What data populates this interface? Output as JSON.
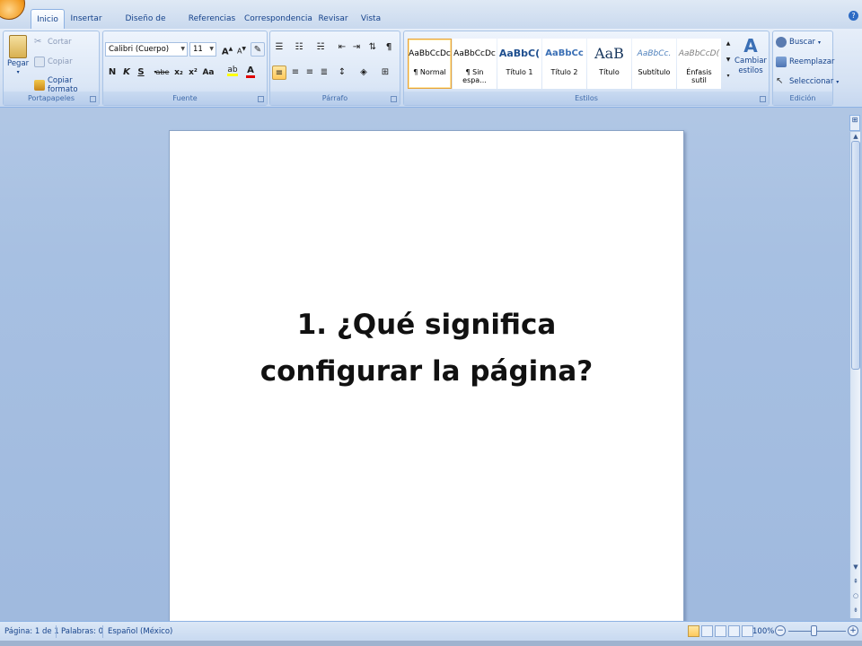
{
  "tabs": [
    {
      "label": "Inicio",
      "active": true
    },
    {
      "label": "Insertar"
    },
    {
      "label": "Diseño de página"
    },
    {
      "label": "Referencias"
    },
    {
      "label": "Correspondencia"
    },
    {
      "label": "Revisar"
    },
    {
      "label": "Vista"
    }
  ],
  "clipboard": {
    "paste": "Pegar",
    "cut": "Cortar",
    "copy": "Copiar",
    "format_painter": "Copiar formato",
    "label": "Portapapeles"
  },
  "font": {
    "family": "Calibri (Cuerpo)",
    "size": "11",
    "label": "Fuente",
    "bold": "N",
    "italic": "K",
    "underline": "S",
    "strike": "abe",
    "subscript": "x₂",
    "superscript": "x²",
    "case": "Aa"
  },
  "paragraph": {
    "label": "Párrafo"
  },
  "styles": {
    "label": "Estilos",
    "items": [
      {
        "preview": "AaBbCcDc",
        "name": "¶ Normal",
        "selected": true
      },
      {
        "preview": "AaBbCcDc",
        "name": "¶ Sin espa..."
      },
      {
        "preview": "AaBbC(",
        "name": "Título 1"
      },
      {
        "preview": "AaBbCc",
        "name": "Título 2"
      },
      {
        "preview": "AaB",
        "name": "Título"
      },
      {
        "preview": "AaBbCc.",
        "name": "Subtítulo"
      },
      {
        "preview": "AaBbCcD(",
        "name": "Énfasis sutil"
      }
    ],
    "change_styles": "Cambiar estilos"
  },
  "editing": {
    "label": "Edición",
    "find": "Buscar",
    "replace": "Reemplazar",
    "select": "Seleccionar"
  },
  "document": {
    "line1": "1. ¿Qué significa",
    "line2": "configurar la página?"
  },
  "status": {
    "page": "Página: 1 de 1",
    "words": "Palabras: 0",
    "language": "Español (México)",
    "zoom": "100%"
  },
  "colors": {
    "accent": "#15428b",
    "ribbon": "#d4e1f3",
    "selected_highlight": "#ffc95c"
  }
}
